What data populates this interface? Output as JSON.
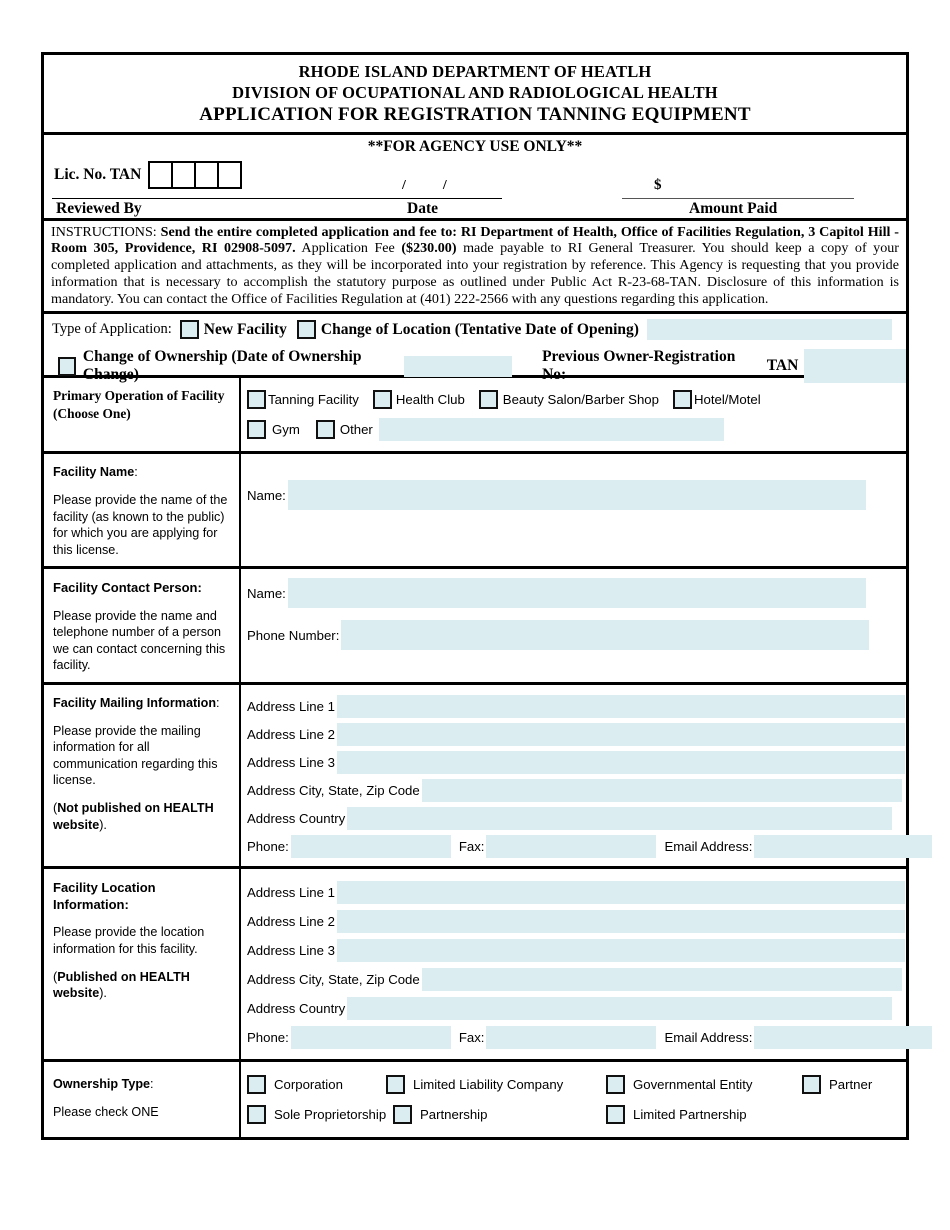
{
  "header": {
    "line1": "RHODE ISLAND DEPARTMENT OF HEATLH",
    "line2": "DIVISION OF OCUPATIONAL AND RADIOLOGICAL HEALTH",
    "line3": "APPLICATION FOR REGISTRATION TANNING EQUIPMENT"
  },
  "agency": {
    "title": "**FOR AGENCY USE ONLY**",
    "lic_label": "Lic. No.   TAN",
    "box_count": 4,
    "slash1": "/",
    "slash2": "/",
    "dollar": "$",
    "reviewed_by_label": "Reviewed By",
    "date_label": "Date",
    "amount_paid_label": "Amount Paid"
  },
  "instructions": {
    "prefix": "INSTRUCTIONS:",
    "bold1": "Send the entire completed application and fee to: RI Department of Health, Office of Facilities Regulation, 3 Capitol Hill - Room 305, Providence, RI  02908-5097.",
    "mid1": "Application Fee",
    "fee": "($230.00)",
    "rest": "made payable to RI General Treasurer.  You should keep a copy of your completed application and attachments, as they will be incorporated into your registration by reference.  This Agency is requesting that you provide information that is necessary to accomplish the statutory purpose as outlined under Public Act R-23-68-TAN.  Disclosure of this information is mandatory. You can contact the Office of Facilities Regulation at (401) 222-2566 with any questions regarding this application."
  },
  "application_type": {
    "label": "Type of Application:",
    "new_facility": "New Facility",
    "change_of_location": "Change of Location  (Tentative Date of Opening)",
    "change_of_ownership": "Change of Ownership (Date of Ownership Change)",
    "previous_owner_label": "Previous Owner-Registration No:",
    "previous_owner_tan": "TAN"
  },
  "primary_operation": {
    "heading": "Primary Operation of Facility",
    "subheading": "(Choose One)",
    "options_row1": [
      "Tanning Facility",
      "Health Club",
      "Beauty Salon/Barber Shop",
      "Hotel/Motel"
    ],
    "options_row2": [
      "Gym",
      "Other"
    ]
  },
  "facility_name": {
    "heading": "Facility Name",
    "heading_colon": ":",
    "description": "Please provide the name of the facility (as known to the public) for which you are applying for this license.",
    "name_label": "Name:"
  },
  "contact_person": {
    "heading": "Facility Contact Person:",
    "description": "Please provide the name and telephone number of a person we can contact concerning this facility.",
    "name_label": "Name:",
    "phone_label": "Phone Number:"
  },
  "mailing": {
    "heading": "Facility Mailing Information",
    "heading_colon": ":",
    "description": "Please provide the mailing information for all communication regarding this license.",
    "note_open": "(",
    "note_bold": "Not published on HEALTH website",
    "note_close": ").",
    "rows": [
      "Address Line 1",
      "Address Line 2",
      "Address Line 3",
      "Address City, State, Zip Code",
      "Address Country"
    ],
    "phone_label": "Phone:",
    "fax_label": "Fax:",
    "email_label": "Email Address:"
  },
  "location": {
    "heading": "Facility Location Information:",
    "description": "Please provide the location information for this facility.",
    "note_open": "(",
    "note_bold": "Published on HEALTH website",
    "note_close": ").",
    "rows": [
      "Address Line 1",
      "Address Line 2",
      "Address Line 3",
      "Address City, State, Zip Code",
      "Address Country"
    ],
    "phone_label": "Phone:",
    "fax_label": "Fax:",
    "email_label": "Email Address:"
  },
  "ownership": {
    "heading": "Ownership Type",
    "heading_colon": ":",
    "instruction": "Please check ONE",
    "options_row1": [
      "Corporation",
      "Limited Liability Company",
      "Governmental Entity",
      "Partner"
    ],
    "options_row2": [
      "Sole Proprietorship",
      "Partnership",
      "Limited Partnership"
    ]
  },
  "colors": {
    "field_fill": "#dcedf1",
    "border": "#000000"
  }
}
